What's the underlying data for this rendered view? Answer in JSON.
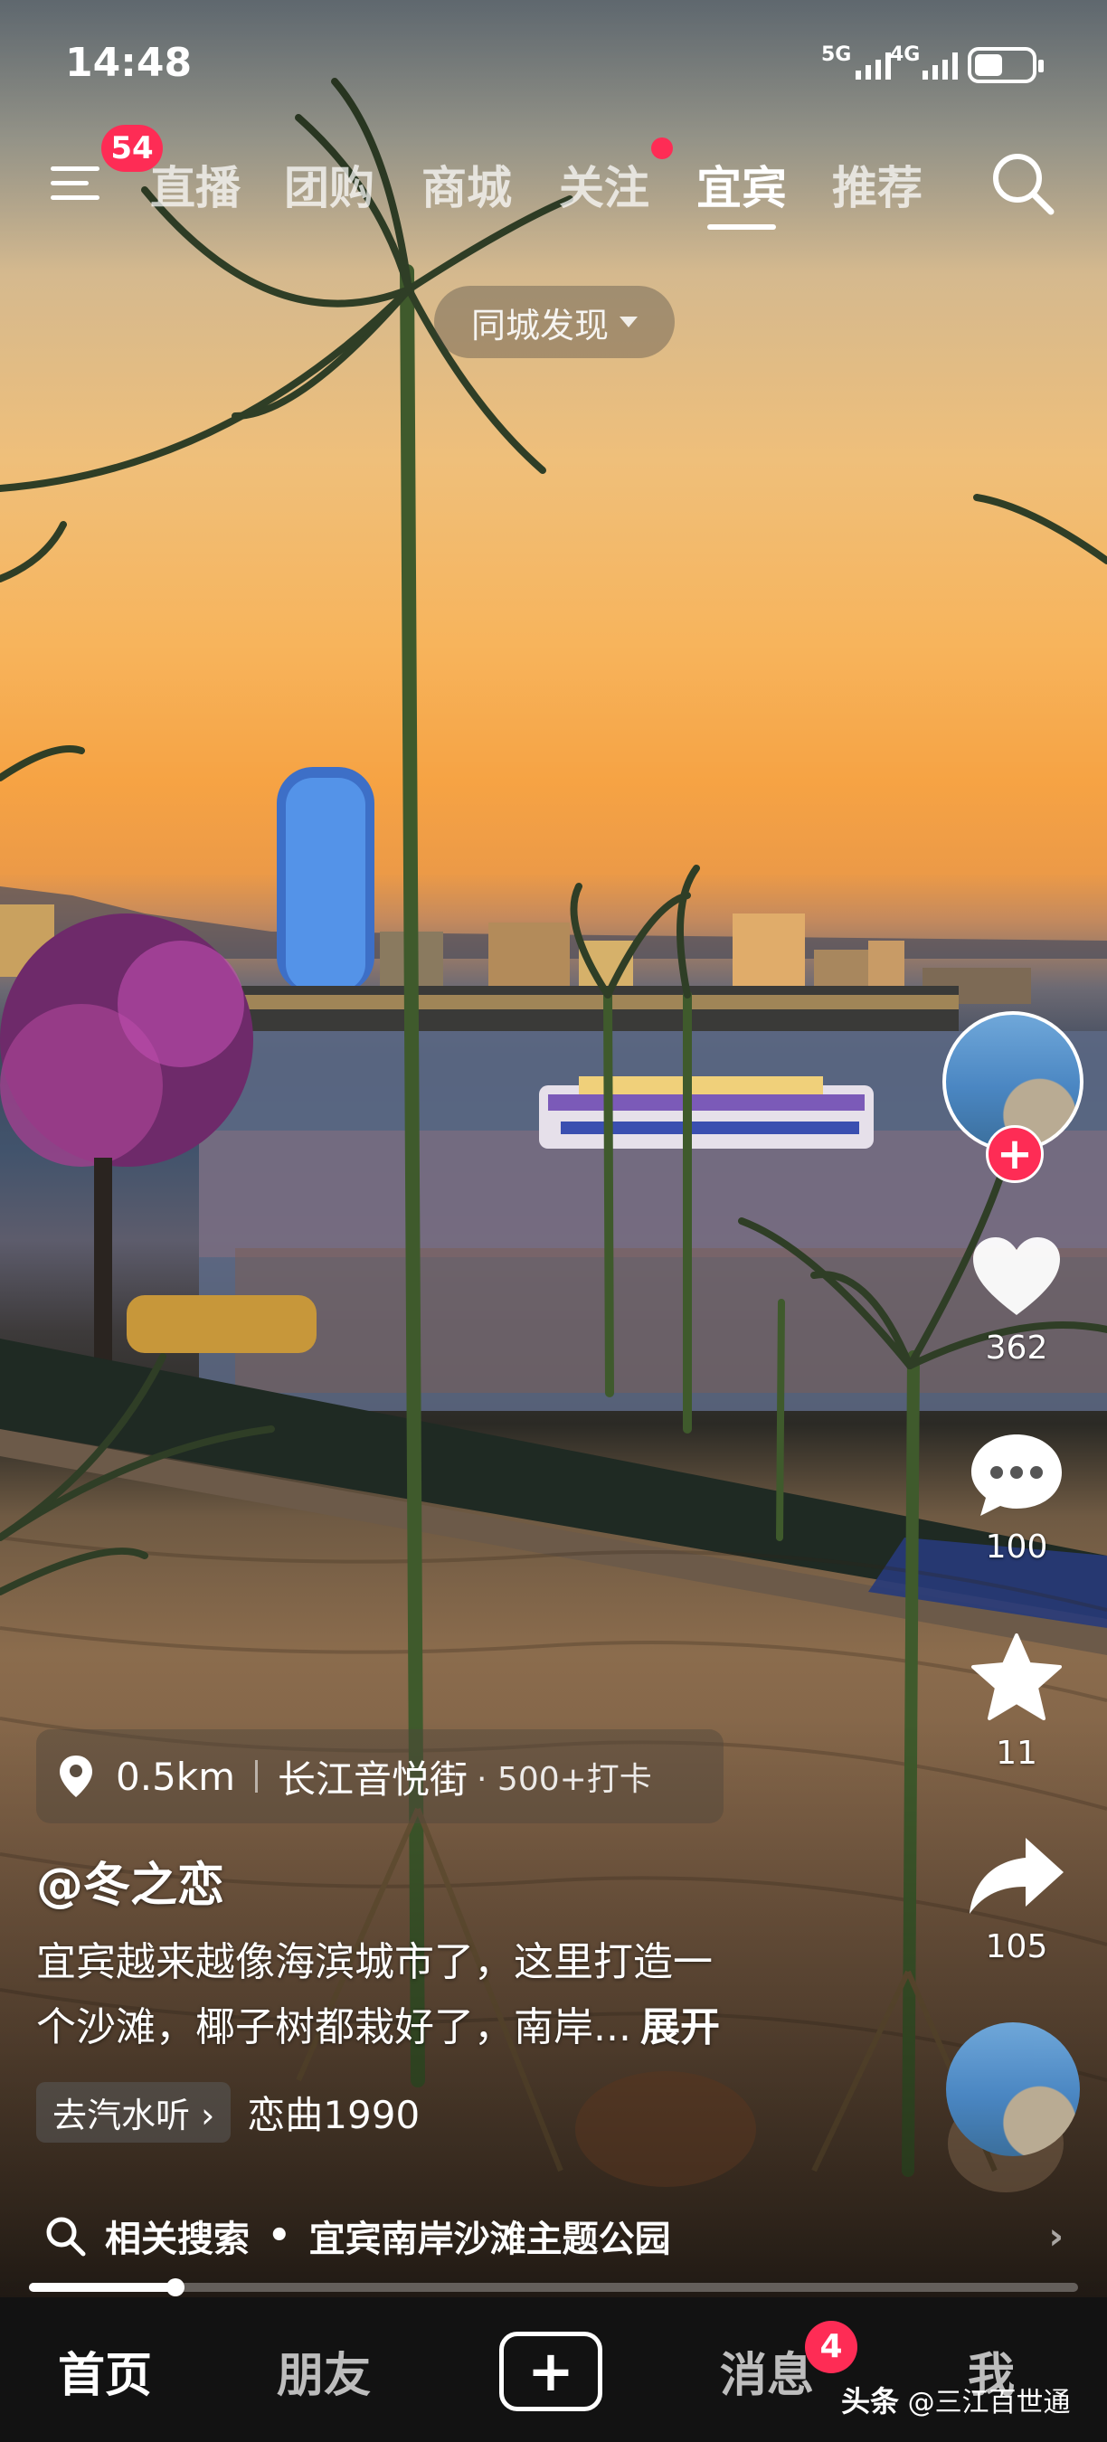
{
  "status_bar": {
    "time": "14:48",
    "signal_1": "5G",
    "signal_2": "4G"
  },
  "top_nav": {
    "menu_badge": "54",
    "tabs": [
      {
        "label": "直播"
      },
      {
        "label": "团购"
      },
      {
        "label": "商城"
      },
      {
        "label": "关注"
      },
      {
        "label": "宜宾"
      },
      {
        "label": "推荐"
      }
    ],
    "active_tab": "宜宾",
    "filter_pill": "同城发现"
  },
  "actions": {
    "likes": "362",
    "comments": "100",
    "favorites": "11",
    "shares": "105"
  },
  "video_info": {
    "location_distance": "0.5km",
    "location_name": "长江音悦街",
    "location_extra": "· 500+打卡",
    "author": "@冬之恋",
    "caption_line1": "宜宾越来越像海滨城市了，这里打造一",
    "caption_line2": "个沙滩，椰子树都栽好了，南岸...",
    "expand_label": "展开",
    "music_tag": "去汽水听",
    "music_title": "恋曲1990",
    "related_label": "相关搜索",
    "related_query": "宜宾南岸沙滩主题公园",
    "progress_fraction": 0.14
  },
  "tab_bar": {
    "items": [
      "首页",
      "朋友",
      "消息",
      "我"
    ],
    "messages_badge": "4"
  },
  "watermark": {
    "source": "头条",
    "account": "@三江百世通"
  },
  "colors": {
    "accent": "#fe2c55",
    "tabbar_bg": "#121212"
  }
}
